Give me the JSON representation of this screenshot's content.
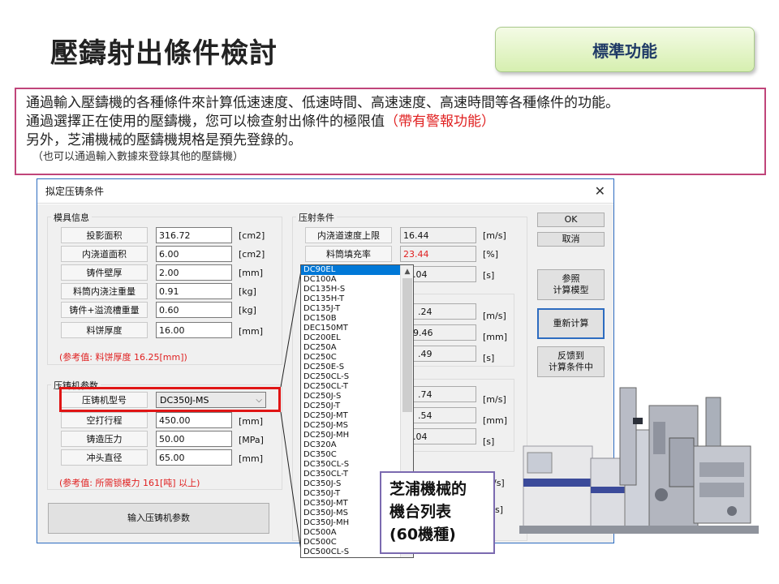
{
  "slide": {
    "title": "壓鑄射出條件檢討",
    "badge": "標準功能"
  },
  "description": {
    "line1": "通過輸入壓鑄機的各種條件來計算低速速度、低速時間、高速速度、高速時間等各種條件的功能。",
    "line2_prefix": "通過選擇正在使用的壓鑄機，您可以檢查射出條件的極限值",
    "line2_red": "（帶有警報功能）",
    "line3": "另外，芝浦機械的壓鑄機規格是預先登錄的。",
    "line4": "（也可以通過輸入數據來登錄其他的壓鑄機）",
    "accent_color": "#e02020"
  },
  "dialog": {
    "title": "拟定压铸条件",
    "close_glyph": "✕",
    "mold_group": {
      "title": "模具信息",
      "rows": [
        {
          "label": "投影面积",
          "value": "316.72",
          "unit": "[cm2]"
        },
        {
          "label": "内浇道面积",
          "value": "6.00",
          "unit": "[cm2]"
        },
        {
          "label": "铸件壁厚",
          "value": "2.00",
          "unit": "[mm]"
        },
        {
          "label": "料筒内浇注重量",
          "value": "0.91",
          "unit": "[kg]"
        },
        {
          "label": "铸件+溢流槽重量",
          "value": "0.60",
          "unit": "[kg]"
        },
        {
          "label": "料饼厚度",
          "value": "16.00",
          "unit": "[mm]"
        }
      ],
      "reference": "(参考值: 料饼厚度 16.25[mm])"
    },
    "machine_group": {
      "title": "压铸机参数",
      "model_label": "压铸机型号",
      "model_value": "DC350J-MS",
      "rows": [
        {
          "label": "空打行程",
          "value": "450.00",
          "unit": "[mm]"
        },
        {
          "label": "铸造压力",
          "value": "50.00",
          "unit": "[MPa]"
        },
        {
          "label": "冲头直径",
          "value": "65.00",
          "unit": "[mm]"
        }
      ],
      "reference": "(参考值: 所需锁模力 161[吨] 以上)",
      "input_button": "输入压铸机参数"
    },
    "injection_group": {
      "title": "压射条件",
      "rows": [
        {
          "label": "内浇道速度上限",
          "value": "16.44",
          "unit": "[m/s]"
        },
        {
          "label": "料筒填充率",
          "value": "23.44",
          "unit": "[%]"
        }
      ],
      "partial_values": [
        ".04",
        ".24",
        "9.46",
        ".49",
        ".74",
        ".54",
        ".04"
      ],
      "partial_units": [
        "[s]",
        "[m/s]",
        "[mm]",
        "[s]",
        "[m/s]",
        "[mm]",
        "[s]",
        "/s]",
        "s]"
      ]
    },
    "buttons": {
      "ok": "OK",
      "cancel": "取消",
      "ref_model": "参照\n计算模型",
      "recalc": "重新计算",
      "feedback": "反馈到\n计算条件中"
    },
    "model_list": [
      "DC90EL",
      "DC100A",
      "DC135H-S",
      "DC135H-T",
      "DC135J-T",
      "DC150B",
      "DEC150MT",
      "DC200EL",
      "DC250A",
      "DC250C",
      "DC250E-S",
      "DC250CL-S",
      "DC250CL-T",
      "DC250J-S",
      "DC250J-T",
      "DC250J-MT",
      "DC250J-MS",
      "DC250J-MH",
      "DC320A",
      "DC350C",
      "DC350CL-S",
      "DC350CL-T",
      "DC350J-S",
      "DC350J-T",
      "DC350J-MT",
      "DC350J-MS",
      "DC350J-MH",
      "DC500A",
      "DC500C",
      "DC500CL-S"
    ]
  },
  "callout": {
    "line1": "芝浦機械的",
    "line2": "機台列表",
    "line3": "(60機種)"
  }
}
